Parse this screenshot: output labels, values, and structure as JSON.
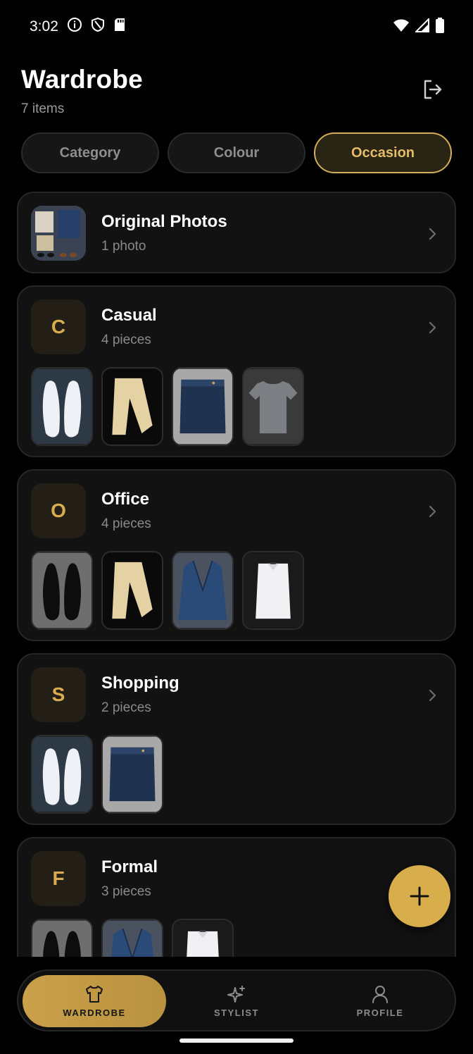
{
  "status": {
    "time": "3:02"
  },
  "header": {
    "title": "Wardrobe",
    "count": "7 items"
  },
  "chips": [
    "Category",
    "Colour",
    "Occasion"
  ],
  "active_chip": "Occasion",
  "cards": [
    {
      "title": "Original Photos",
      "sub": "1 photo"
    },
    {
      "letter": "C",
      "title": "Casual",
      "sub": "4 pieces"
    },
    {
      "letter": "O",
      "title": "Office",
      "sub": "4 pieces"
    },
    {
      "letter": "S",
      "title": "Shopping",
      "sub": "2 pieces"
    },
    {
      "letter": "F",
      "title": "Formal",
      "sub": "3 pieces"
    }
  ],
  "nav": {
    "wardrobe": "WARDROBE",
    "stylist": "STYLIST",
    "profile": "PROFILE"
  },
  "colors": {
    "accent": "#d8ad4c",
    "bg": "#000000",
    "card": "#121212"
  }
}
